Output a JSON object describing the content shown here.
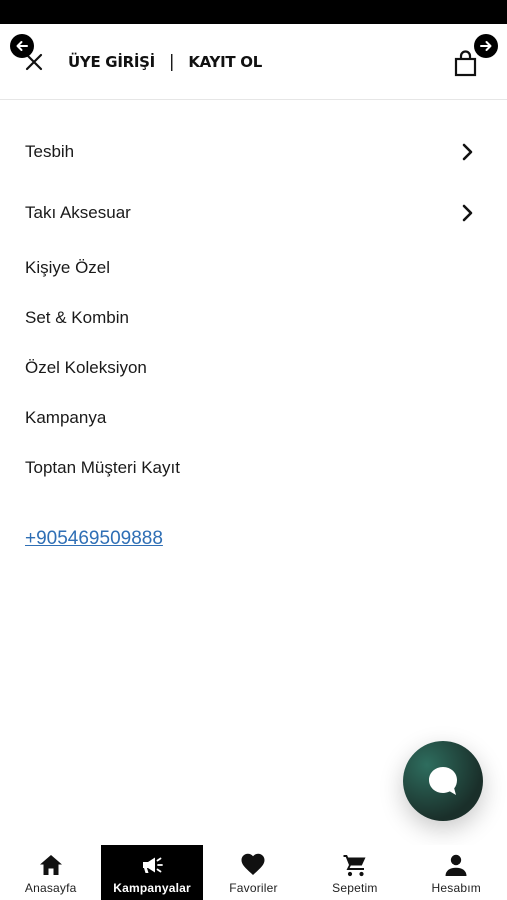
{
  "header": {
    "login_label": "ÜYE GİRİŞİ",
    "separator": "|",
    "register_label": "KAYIT OL"
  },
  "menu": {
    "items": [
      {
        "label": "Tesbih",
        "has_submenu": true
      },
      {
        "label": "Takı Aksesuar",
        "has_submenu": true
      },
      {
        "label": "Kişiye Özel",
        "has_submenu": false
      },
      {
        "label": "Set & Kombin",
        "has_submenu": false
      },
      {
        "label": "Özel Koleksiyon",
        "has_submenu": false
      },
      {
        "label": "Kampanya",
        "has_submenu": false
      },
      {
        "label": "Toptan Müşteri Kayıt",
        "has_submenu": false
      }
    ]
  },
  "contact": {
    "phone": "+905469509888",
    "link_color": "#2f6fb5"
  },
  "chat": {
    "icon": "chat-bubble-icon"
  },
  "bottom_nav": {
    "active": "Kampanyalar",
    "tabs": [
      {
        "label": "Anasayfa",
        "icon": "home-icon"
      },
      {
        "label": "Kampanyalar",
        "icon": "megaphone-icon"
      },
      {
        "label": "Favoriler",
        "icon": "heart-icon"
      },
      {
        "label": "Sepetim",
        "icon": "cart-icon"
      },
      {
        "label": "Hesabım",
        "icon": "person-icon"
      }
    ]
  },
  "colors": {
    "active_tab_bg": "#000000",
    "chat_button": "#244a41"
  }
}
